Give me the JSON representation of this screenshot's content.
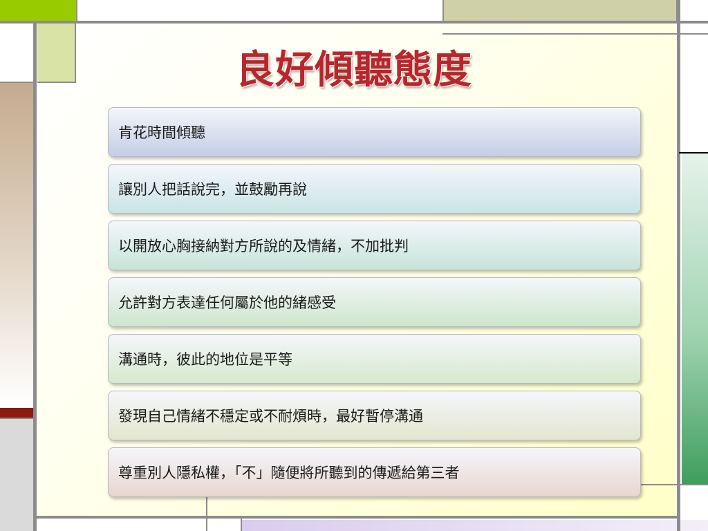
{
  "slide": {
    "title": "良好傾聽態度",
    "items": [
      {
        "text": "肯花時間傾聽",
        "color": "#c4cde6"
      },
      {
        "text": "讓別人把話說完，並鼓勵再說",
        "color": "#c9e4e6"
      },
      {
        "text": "以開放心胸接納對方所說的及情緒，不加批判",
        "color": "#c6e4d8"
      },
      {
        "text": "允許對方表達任何屬於他的緒感受",
        "color": "#cde6cd"
      },
      {
        "text": "溝通時，彼此的地位是平等",
        "color": "#d6e9cd"
      },
      {
        "text": "發現自己情緒不穩定或不耐煩時，最好暫停溝通",
        "color": "#e3e6cf"
      },
      {
        "text": "尊重別人隱私權，「不」隨便將所聽到的傳遞給第三者",
        "color": "#e8d6d0"
      }
    ]
  }
}
